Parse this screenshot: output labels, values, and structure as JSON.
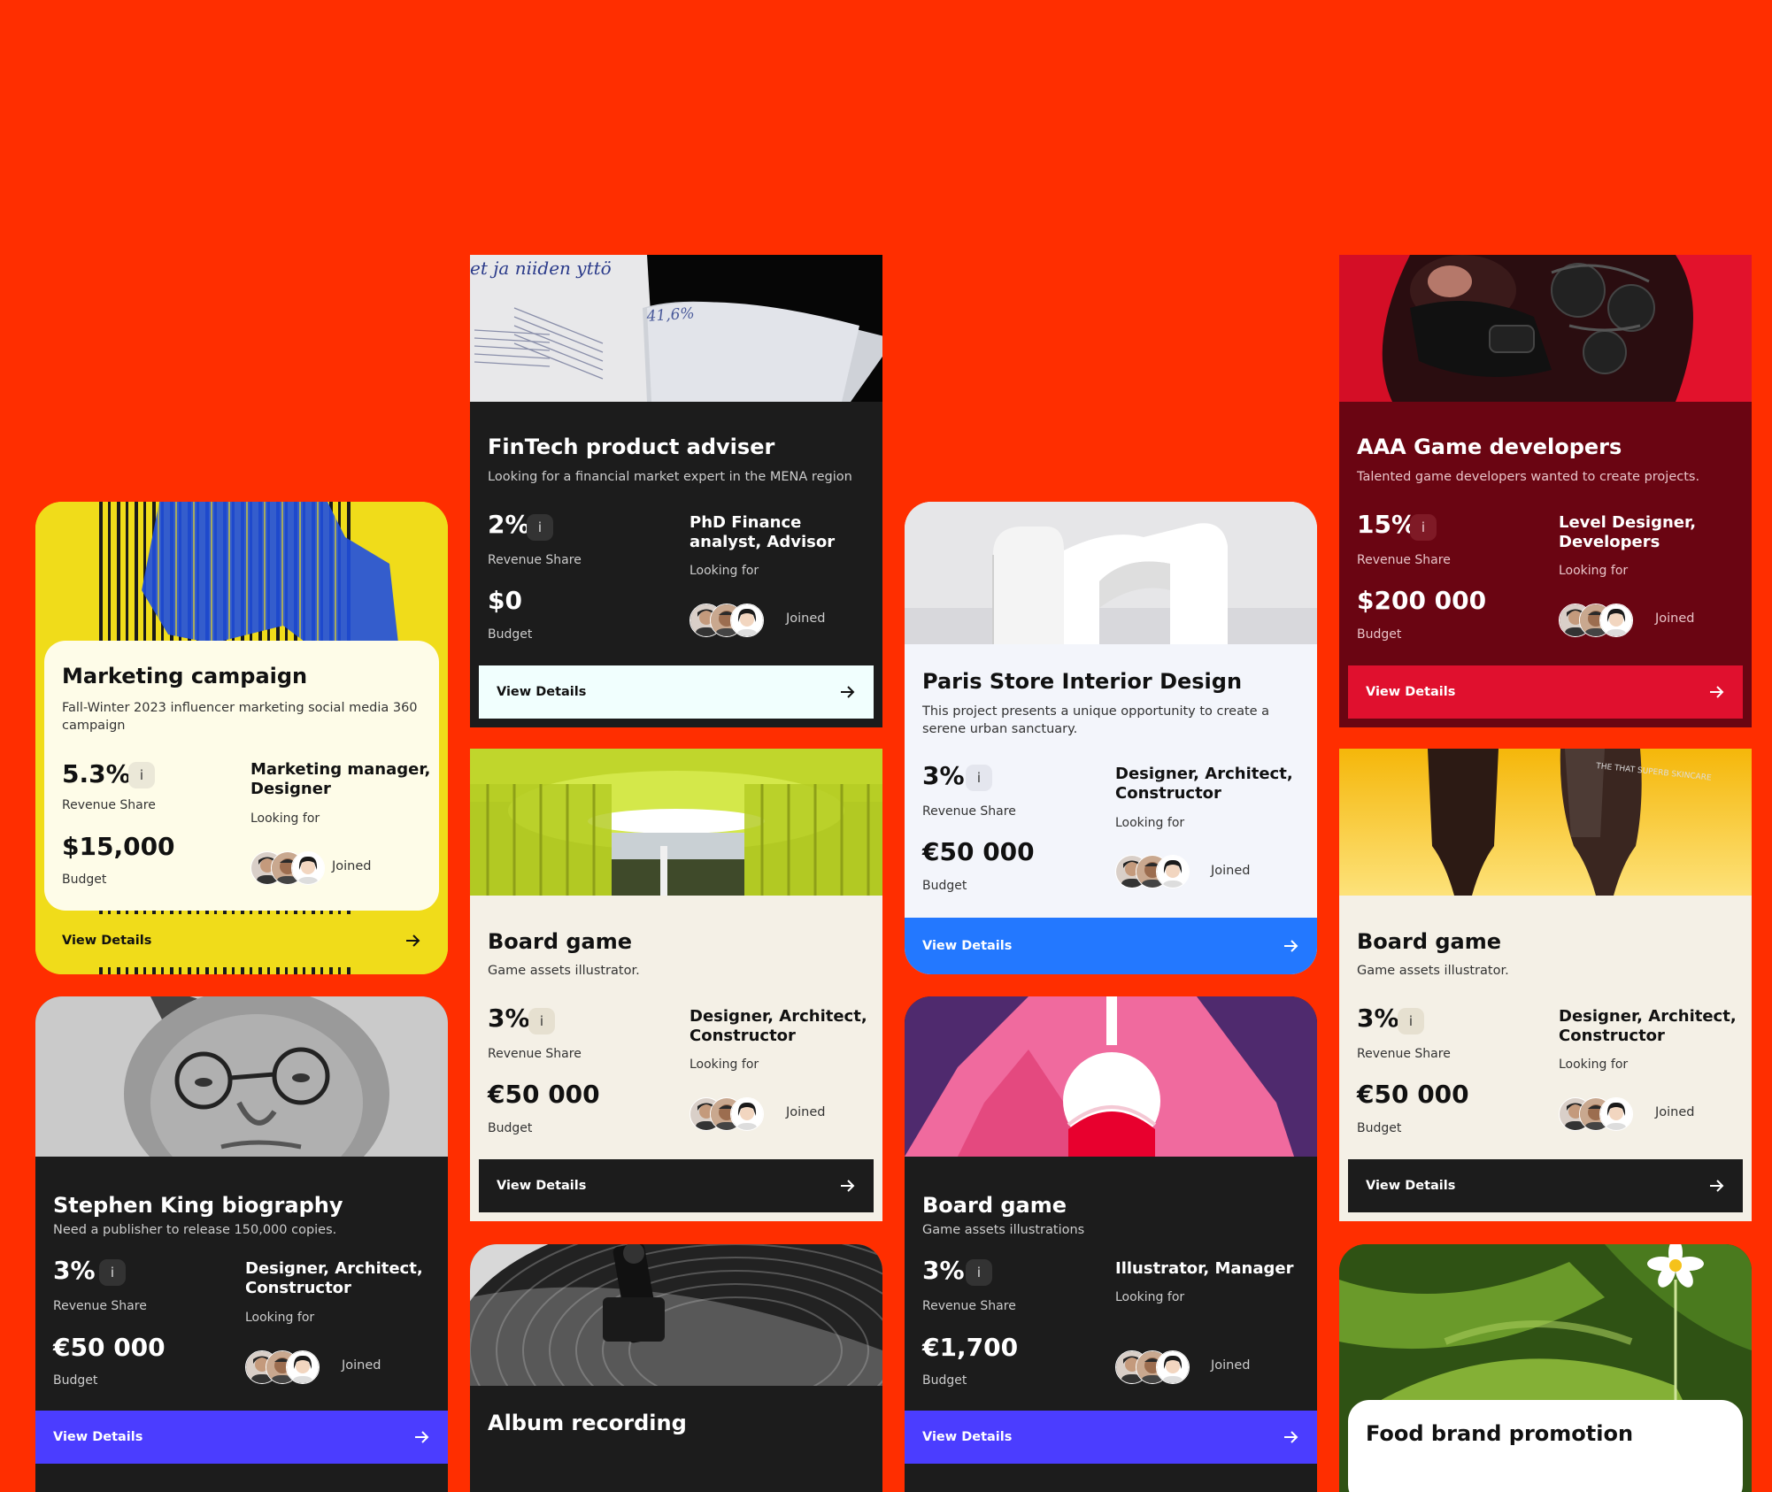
{
  "common": {
    "revenue_label": "Revenue Share",
    "budget_label": "Budget",
    "looking_label": "Looking for",
    "joined_label": "Joined",
    "details_label": "View Details",
    "info_label": "i"
  },
  "cards": [
    {
      "title": "Marketing campaign",
      "desc": "Fall-Winter 2023 influencer marketing social media 360 campaign",
      "pct": "5.3%",
      "budget": "$15,000",
      "roles": "Marketing manager, Designer"
    },
    {
      "title": "FinTech product adviser",
      "desc": "Looking for a financial market expert in the MENA region",
      "pct": "2%",
      "budget": "$0",
      "roles": "PhD Finance analyst, Advisor"
    },
    {
      "title": "Paris Store Interior Design",
      "desc": "This project presents a unique opportunity to create a serene urban sanctuary.",
      "pct": "3%",
      "budget": "€50 000",
      "roles": "Designer, Architect, Constructor"
    },
    {
      "title": "AAA Game developers",
      "desc": "Talented game developers wanted to create projects.",
      "pct": "15%",
      "budget": "$200 000",
      "roles": "Level Designer, Developers"
    },
    {
      "title": "Stephen King biography",
      "desc": "Need a publisher to release 150,000 copies.",
      "pct": "3%",
      "budget": "€50 000",
      "roles": "Designer, Architect, Constructor"
    },
    {
      "title": "Board game",
      "desc": "Game assets illustrator.",
      "pct": "3%",
      "budget": "€50 000",
      "roles": "Designer, Architect, Constructor"
    },
    {
      "title": "Board game",
      "desc": "Game assets illustrations",
      "pct": "3%",
      "budget": "€1,700",
      "roles": "Illustrator, Manager"
    },
    {
      "title": "Board game",
      "desc": "Game assets illustrator.",
      "pct": "3%",
      "budget": "€50 000",
      "roles": "Designer, Architect, Constructor"
    },
    {
      "title": "Album recording",
      "desc": ""
    },
    {
      "title": "Food brand promotion"
    }
  ],
  "image_texts": {
    "book_heading": "et ja niiden yttö",
    "book_number": "41,6%",
    "tube_label": "THE THAT SUPERB SKINCARE"
  },
  "colors": {
    "page_bg": "#ff2e00",
    "blue_button": "#2378ff",
    "violet_button": "#4b3dff",
    "crimson": "#e0102e",
    "yellow": "#f0dc1a"
  },
  "icons": [
    "arrow-right-icon",
    "info-icon",
    "avatar"
  ]
}
